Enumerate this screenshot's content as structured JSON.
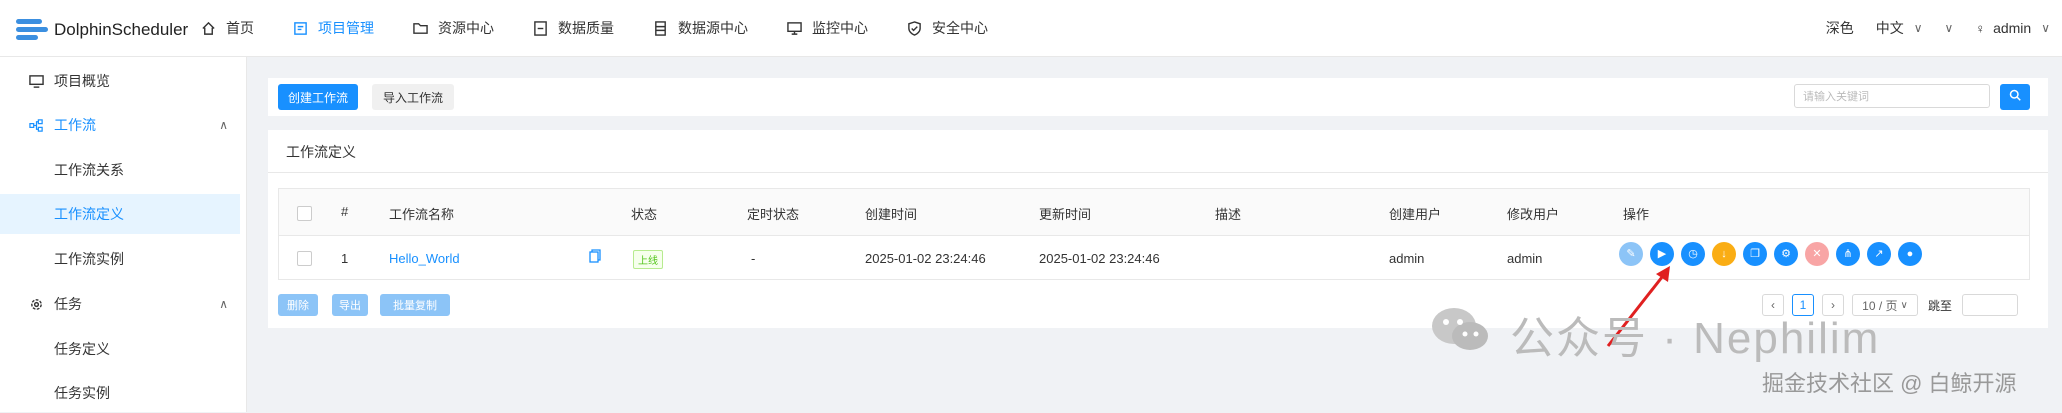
{
  "app": {
    "title": "DolphinScheduler"
  },
  "nav": [
    {
      "label": "首页",
      "icon": "home-icon"
    },
    {
      "label": "项目管理",
      "icon": "project-icon",
      "active": true
    },
    {
      "label": "资源中心",
      "icon": "folder-icon"
    },
    {
      "label": "数据质量",
      "icon": "quality-icon"
    },
    {
      "label": "数据源中心",
      "icon": "datasource-icon"
    },
    {
      "label": "监控中心",
      "icon": "monitor-icon"
    },
    {
      "label": "安全中心",
      "icon": "shield-icon"
    }
  ],
  "header_right": {
    "theme": "深色",
    "language": "中文",
    "user": "admin"
  },
  "sidebar": {
    "overview": "项目概览",
    "workflow": "工作流",
    "workflow_relation": "工作流关系",
    "workflow_definition": "工作流定义",
    "workflow_instance": "工作流实例",
    "task": "任务",
    "task_definition": "任务定义",
    "task_instance": "任务实例"
  },
  "toolbar": {
    "create_label": "创建工作流",
    "import_label": "导入工作流",
    "search_placeholder": "请输入关键词"
  },
  "card": {
    "title": "工作流定义"
  },
  "table": {
    "headers": {
      "index": "#",
      "name": "工作流名称",
      "status": "状态",
      "schedule_status": "定时状态",
      "create_time": "创建时间",
      "update_time": "更新时间",
      "description": "描述",
      "create_user": "创建用户",
      "modify_user": "修改用户",
      "operation": "操作"
    },
    "rows": [
      {
        "index": "1",
        "name": "Hello_World",
        "status": "上线",
        "schedule_status": "-",
        "create_time": "2025-01-02 23:24:46",
        "update_time": "2025-01-02 23:24:46",
        "description": "",
        "create_user": "admin",
        "modify_user": "admin"
      }
    ],
    "operation_icons": [
      {
        "icon": "edit-icon",
        "color": "#8cc4f7"
      },
      {
        "icon": "run-icon",
        "color": "#1890ff"
      },
      {
        "icon": "timing-icon",
        "color": "#1890ff"
      },
      {
        "icon": "offline-icon",
        "color": "#faad14"
      },
      {
        "icon": "copy-icon",
        "color": "#1890ff"
      },
      {
        "icon": "gear-icon",
        "color": "#1890ff"
      },
      {
        "icon": "delete-icon",
        "color": "#f8a5a5"
      },
      {
        "icon": "tree-icon",
        "color": "#1890ff"
      },
      {
        "icon": "export-icon",
        "color": "#1890ff"
      },
      {
        "icon": "version-icon",
        "color": "#1890ff"
      }
    ]
  },
  "footer": {
    "delete_label": "删除",
    "export_label": "导出",
    "batch_copy_label": "批量复制",
    "page": "1",
    "page_size": "10 / 页",
    "goto_label": "跳至"
  },
  "watermark": {
    "line1": "公众号 · Nephilim",
    "line2": "掘金技术社区 @ 白鲸开源"
  },
  "colors": {
    "primary": "#1890ff",
    "online_tag": "#52c41a",
    "warning": "#faad14"
  }
}
